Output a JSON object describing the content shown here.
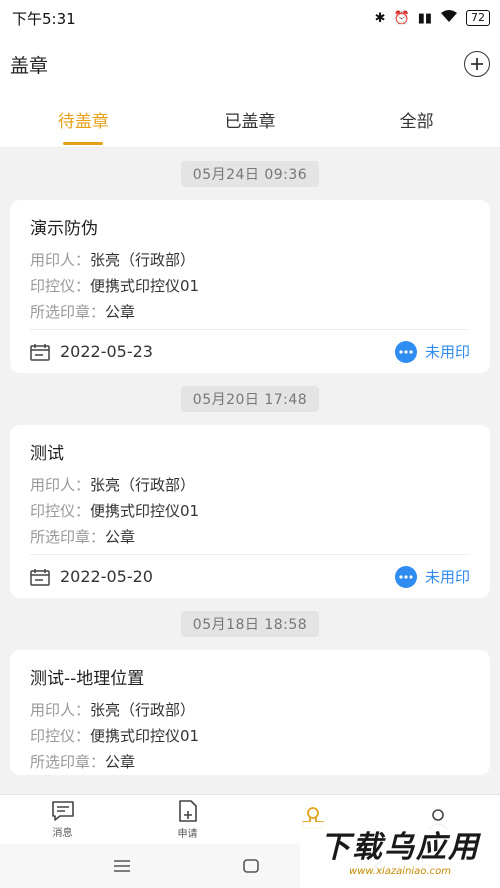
{
  "status_bar": {
    "time": "下午5:31",
    "battery": "72"
  },
  "header": {
    "title": "盖章"
  },
  "tabs": [
    {
      "label": "待盖章",
      "active": true
    },
    {
      "label": "已盖章",
      "active": false
    },
    {
      "label": "全部",
      "active": false
    }
  ],
  "fields": {
    "user": "用印人：",
    "device": "印控仪：",
    "seal": "所选印章："
  },
  "groups": [
    {
      "time": "05月24日 09:36",
      "title": "演示防伪",
      "user": "张亮（行政部）",
      "device": "便携式印控仪01",
      "seal": "公章",
      "date": "2022-05-23",
      "status": "未用印"
    },
    {
      "time": "05月20日 17:48",
      "title": "测试",
      "user": "张亮（行政部）",
      "device": "便携式印控仪01",
      "seal": "公章",
      "date": "2022-05-20",
      "status": "未用印"
    },
    {
      "time": "05月18日 18:58",
      "title": "测试--地理位置",
      "user": "张亮（行政部）",
      "device": "便携式印控仪01",
      "seal": "公章",
      "date": "",
      "status": ""
    }
  ],
  "bottom_nav": [
    {
      "label": "消息",
      "icon": "message-icon"
    },
    {
      "label": "申请",
      "icon": "apply-icon"
    },
    {
      "label": "",
      "icon": "seal-icon"
    },
    {
      "label": "",
      "icon": "profile-icon"
    }
  ],
  "watermark": {
    "main": "下载乌应用",
    "sub": "www.xiazainiao.com"
  },
  "colors": {
    "accent": "#e6a11a",
    "status_blue": "#2f8cf0"
  }
}
